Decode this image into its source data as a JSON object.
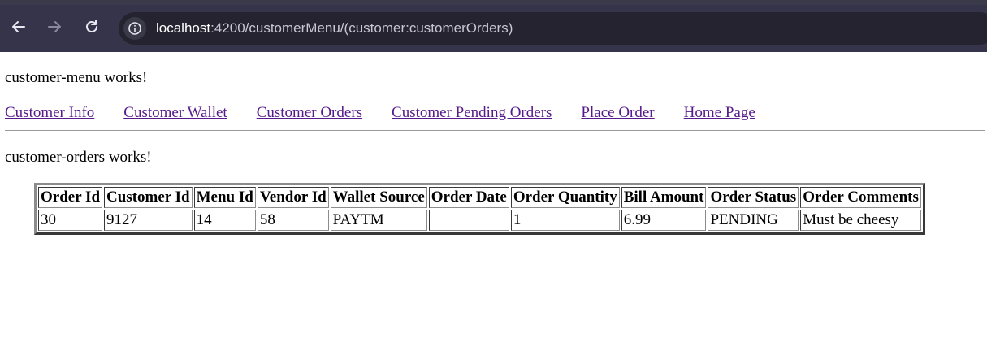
{
  "browser": {
    "url_host": "localhost",
    "url_path": ":4200/customerMenu/(customer:customerOrders)"
  },
  "page": {
    "menu_heading": "customer-menu works!",
    "orders_heading": "customer-orders works!"
  },
  "nav": {
    "links": [
      "Customer Info",
      "Customer Wallet",
      "Customer Orders",
      "Customer Pending Orders",
      "Place Order",
      "Home Page"
    ]
  },
  "colors": {
    "link_visited": "#551a8b",
    "browser_toolbar": "#35344a",
    "omnibox": "#24232f"
  },
  "orders_table": {
    "headers": [
      "Order Id",
      "Customer Id",
      "Menu Id",
      "Vendor Id",
      "Wallet Source",
      "Order Date",
      "Order Quantity",
      "Bill Amount",
      "Order Status",
      "Order Comments"
    ],
    "rows": [
      [
        "30",
        "9127",
        "14",
        "58",
        "PAYTM",
        "",
        "1",
        "6.99",
        "PENDING",
        "Must be cheesy"
      ]
    ]
  }
}
